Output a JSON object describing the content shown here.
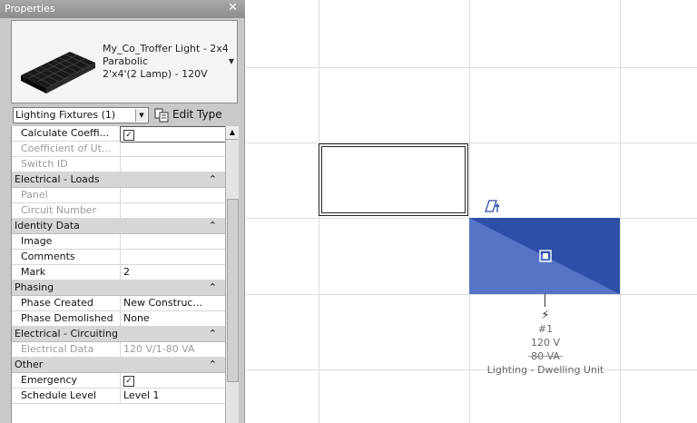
{
  "palette": {
    "title": "Properties",
    "close_glyph": "✕",
    "type": {
      "line1": "My_Co_Troffer Light - 2x4",
      "line2": "Parabolic",
      "line3": "2'x4'(2 Lamp) - 120V"
    },
    "category_filter": "Lighting Fixtures (1)",
    "edit_type_label": "Edit Type",
    "rows": [
      {
        "kind": "param",
        "name": "Calculate Coeffi...",
        "value": "",
        "checkbox": true,
        "checked": true,
        "focused": true
      },
      {
        "kind": "param",
        "name": "Coefficient of Ut...",
        "value": "",
        "disabled": true
      },
      {
        "kind": "param",
        "name": "Switch ID",
        "value": "",
        "disabled": true
      },
      {
        "kind": "group",
        "name": "Electrical - Loads",
        "toggle": "⌃"
      },
      {
        "kind": "param",
        "name": "Panel",
        "value": "",
        "disabled": true
      },
      {
        "kind": "param",
        "name": "Circuit Number",
        "value": "",
        "disabled": true
      },
      {
        "kind": "group",
        "name": "Identity Data",
        "toggle": "⌃"
      },
      {
        "kind": "param",
        "name": "Image",
        "value": ""
      },
      {
        "kind": "param",
        "name": "Comments",
        "value": ""
      },
      {
        "kind": "param",
        "name": "Mark",
        "value": "2"
      },
      {
        "kind": "group",
        "name": "Phasing",
        "toggle": "⌃"
      },
      {
        "kind": "param",
        "name": "Phase Created",
        "value": "New Construc..."
      },
      {
        "kind": "param",
        "name": "Phase Demolished",
        "value": "None"
      },
      {
        "kind": "group",
        "name": "Electrical - Circuiting",
        "toggle": "⌃"
      },
      {
        "kind": "param",
        "name": "Electrical Data",
        "value": "120 V/1-80 VA",
        "disabled": true
      },
      {
        "kind": "group",
        "name": "Other",
        "toggle": "⌃"
      },
      {
        "kind": "param",
        "name": "Emergency",
        "value": "",
        "checkbox": true,
        "checked": true
      },
      {
        "kind": "param",
        "name": "Schedule Level",
        "value": "Level 1"
      }
    ]
  },
  "canvas": {
    "fixture_color": "#2d4fa8",
    "fixture_color_light": "#5574c6",
    "tag": {
      "bolt_icon": "⚡",
      "number": "#1",
      "voltage": "120 V",
      "load": "80 VA",
      "label": "Lighting - Dwelling Unit"
    }
  }
}
